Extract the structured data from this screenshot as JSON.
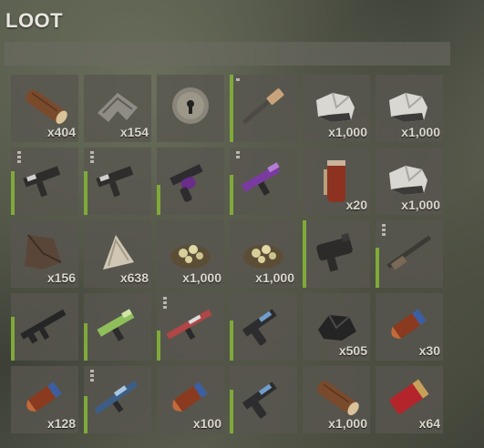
{
  "panel": {
    "title": "LOOT",
    "filter_text": ""
  },
  "slots": [
    {
      "name": "slot-wood-log",
      "icon": "wood-log-icon",
      "qty": "x404",
      "cond": 0,
      "mods": 0
    },
    {
      "name": "slot-cloth-rags",
      "icon": "cloth-scrap-icon",
      "qty": "x154",
      "cond": 0,
      "mods": 0
    },
    {
      "name": "slot-metal-pot",
      "icon": "metal-pot-icon",
      "qty": "",
      "cond": 0,
      "mods": 0
    },
    {
      "name": "slot-shotgun",
      "icon": "shotgun-icon",
      "qty": "",
      "cond": 1.0,
      "mods": 1
    },
    {
      "name": "slot-stone-pile",
      "icon": "stone-pile-icon",
      "qty": "x1,000",
      "cond": 0,
      "mods": 0
    },
    {
      "name": "slot-stone-pile-2",
      "icon": "stone-pile-icon",
      "qty": "x1,000",
      "cond": 0,
      "mods": 0
    },
    {
      "name": "slot-smg",
      "icon": "smg-icon",
      "qty": "",
      "cond": 0.65,
      "mods": 3
    },
    {
      "name": "slot-smg-2",
      "icon": "smg-icon",
      "qty": "",
      "cond": 0.65,
      "mods": 3
    },
    {
      "name": "slot-revolver",
      "icon": "revolver-icon",
      "qty": "",
      "cond": 0.45,
      "mods": 0
    },
    {
      "name": "slot-purple-smg",
      "icon": "purple-smg-icon",
      "qty": "",
      "cond": 0.6,
      "mods": 2
    },
    {
      "name": "slot-rocket-tube",
      "icon": "tube-icon",
      "qty": "x20",
      "cond": 0,
      "mods": 0
    },
    {
      "name": "slot-stone-pile-3",
      "icon": "stone-pile-icon",
      "qty": "x1,000",
      "cond": 0,
      "mods": 0
    },
    {
      "name": "slot-leather-hide",
      "icon": "hide-icon",
      "qty": "x156",
      "cond": 0,
      "mods": 0
    },
    {
      "name": "slot-cloth",
      "icon": "cloth-icon",
      "qty": "x638",
      "cond": 0,
      "mods": 0
    },
    {
      "name": "slot-sulfur-ore",
      "icon": "ore-icon",
      "qty": "x1,000",
      "cond": 0,
      "mods": 0
    },
    {
      "name": "slot-sulfur-ore-2",
      "icon": "ore-icon",
      "qty": "x1,000",
      "cond": 0,
      "mods": 0
    },
    {
      "name": "slot-launcher",
      "icon": "launcher-icon",
      "qty": "",
      "cond": 1.0,
      "mods": 0
    },
    {
      "name": "slot-rifle",
      "icon": "rifle-icon",
      "qty": "",
      "cond": 0.6,
      "mods": 3
    },
    {
      "name": "slot-assault-rifle",
      "icon": "assault-rifle-icon",
      "qty": "",
      "cond": 0.65,
      "mods": 0
    },
    {
      "name": "slot-green-smg",
      "icon": "green-smg-icon",
      "qty": "",
      "cond": 0.55,
      "mods": 0
    },
    {
      "name": "slot-red-rifle",
      "icon": "red-rifle-icon",
      "qty": "",
      "cond": 0.45,
      "mods": 3
    },
    {
      "name": "slot-pistol-blue",
      "icon": "pistol-icon",
      "qty": "",
      "cond": 0.6,
      "mods": 0
    },
    {
      "name": "slot-coal",
      "icon": "coal-icon",
      "qty": "x505",
      "cond": 0,
      "mods": 0
    },
    {
      "name": "slot-ammo-blue",
      "icon": "ammo-icon",
      "qty": "x30",
      "cond": 0,
      "mods": 0
    },
    {
      "name": "slot-ammo-brown",
      "icon": "ammo-icon",
      "qty": "x128",
      "cond": 0,
      "mods": 0
    },
    {
      "name": "slot-blue-rifle",
      "icon": "blue-rifle-icon",
      "qty": "",
      "cond": 0.55,
      "mods": 3
    },
    {
      "name": "slot-ammo-red",
      "icon": "ammo-icon",
      "qty": "x100",
      "cond": 0,
      "mods": 0
    },
    {
      "name": "slot-pistol",
      "icon": "pistol-icon",
      "qty": "",
      "cond": 0.65,
      "mods": 0
    },
    {
      "name": "slot-wood-log-2",
      "icon": "wood-log-icon",
      "qty": "x1,000",
      "cond": 0,
      "mods": 0
    },
    {
      "name": "slot-shotgun-shell",
      "icon": "shell-icon",
      "qty": "x64",
      "cond": 0,
      "mods": 0
    }
  ],
  "colors": {
    "condition_bar": "#7faa3a",
    "slot_bg": "#58564f",
    "title_text": "#e8e6df"
  }
}
